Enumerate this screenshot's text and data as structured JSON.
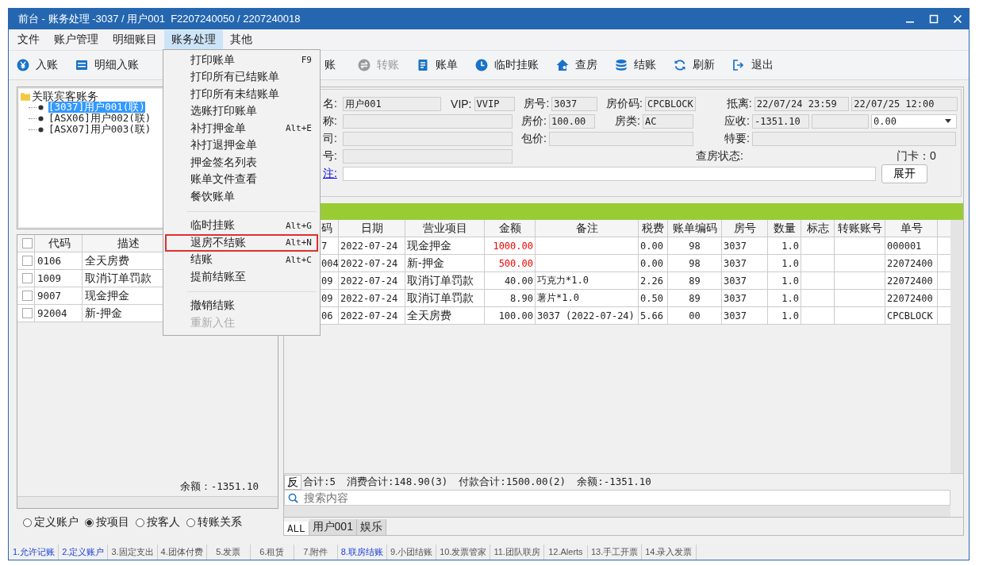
{
  "window": {
    "title": "前台 - 账务处理 -3037 / 用户001  F2207240050 / 2207240018"
  },
  "menu_bar": [
    {
      "label": "文件",
      "selected": false
    },
    {
      "label": "账户管理",
      "selected": false
    },
    {
      "label": "明细账目",
      "selected": false
    },
    {
      "label": "账务处理",
      "selected": true
    },
    {
      "label": "其他",
      "selected": false
    }
  ],
  "toolbar": [
    {
      "label": "入账",
      "disabled": false
    },
    {
      "label": "明细入账",
      "disabled": false
    },
    {
      "label": "账",
      "disabled": false
    },
    {
      "label": "转账",
      "disabled": true
    },
    {
      "label": "账单",
      "disabled": false
    },
    {
      "label": "临时挂账",
      "disabled": false
    },
    {
      "label": "查房",
      "disabled": false
    },
    {
      "label": "结账",
      "disabled": false
    },
    {
      "label": "刷新",
      "disabled": false
    },
    {
      "label": "退出",
      "disabled": false
    }
  ],
  "tree": {
    "root": "关联宾客账务",
    "children": [
      {
        "label": "[3037]用户001(联)",
        "selected": true
      },
      {
        "label": "[ASX06]用户002(联)",
        "selected": false
      },
      {
        "label": "[ASX07]用户003(联)",
        "selected": false
      }
    ]
  },
  "item_grid": {
    "header_checked": false,
    "columns": [
      "代码",
      "描述"
    ],
    "rows": [
      {
        "code": "0106",
        "desc": "全天房费",
        "checked": false
      },
      {
        "code": "1009",
        "desc": "取消订单罚款",
        "checked": false
      },
      {
        "code": "9007",
        "desc": "现金押金",
        "checked": false
      },
      {
        "code": "92004",
        "desc": "新-押金",
        "checked": false
      }
    ],
    "balance": "余额：-1351.10"
  },
  "view_options": [
    {
      "label": "定义账户",
      "selected": false
    },
    {
      "label": "按项目",
      "selected": true
    },
    {
      "label": "按客人",
      "selected": false
    },
    {
      "label": "转账关系",
      "selected": false
    }
  ],
  "guest_form": {
    "name_label": "名:",
    "name": "用户001",
    "vip_label": "VIP:",
    "vip": "VVIP",
    "room_label": "房号:",
    "room": "3037",
    "rate_code_label": "房价码:",
    "rate_code": "CPCBLOCK",
    "stay_label": "抵离:",
    "arrival": "22/07/24 23:59",
    "departure": "22/07/25 12:00",
    "title_label": "称:",
    "rate_label": "房价:",
    "rate": "100.00",
    "room_type_label": "房类:",
    "room_type": "AC",
    "receivable_label": "应收:",
    "receivable": "-1351.10",
    "receivable_select": "0.00",
    "company_label": "司:",
    "package_label": "包价:",
    "special_label": "特要:",
    "number_label": "号:",
    "check_status_label": "查房状态:",
    "door_card": "门卡：0",
    "remark_link": "注:",
    "expand_button": "展开"
  },
  "ledger": {
    "columns": [
      "码",
      "日期",
      "营业项目",
      "金额",
      "备注",
      "税费",
      "账单编码",
      "房号",
      "数量",
      "标志",
      "转账账号",
      "单号"
    ],
    "rows": [
      {
        "code": "7",
        "date": "2022-07-24",
        "item": "现金押金",
        "amount": "1000.00",
        "remark": "",
        "tax": "0.00",
        "bill_code": "98",
        "room": "3037",
        "qty": "1.0",
        "bill_no": "000001",
        "kind": "payment"
      },
      {
        "code": "004",
        "date": "2022-07-24",
        "item": "新-押金",
        "amount": "500.00",
        "remark": "",
        "tax": "0.00",
        "bill_code": "98",
        "room": "3037",
        "qty": "1.0",
        "bill_no": "22072400",
        "kind": "payment"
      },
      {
        "code": "09",
        "date": "2022-07-24",
        "item": "取消订单罚款",
        "amount": "40.00",
        "remark": "巧克力*1.0",
        "tax": "2.26",
        "bill_code": "89",
        "room": "3037",
        "qty": "1.0",
        "bill_no": "22072400",
        "kind": "charge"
      },
      {
        "code": "09",
        "date": "2022-07-24",
        "item": "取消订单罚款",
        "amount": "8.90",
        "remark": "薯片*1.0",
        "tax": "0.50",
        "bill_code": "89",
        "room": "3037",
        "qty": "1.0",
        "bill_no": "22072400",
        "kind": "charge"
      },
      {
        "code": "06",
        "date": "2022-07-24",
        "item": "全天房费",
        "amount": "100.00",
        "remark": "3037 (2022-07-24)",
        "tax": "5.66",
        "bill_code": "00",
        "room": "3037",
        "qty": "1.0",
        "bill_no": "CPCBLOCK",
        "kind": "charge"
      }
    ]
  },
  "summary": {
    "reverse_button": "反",
    "count": "合计:5",
    "consumption": "消费合计:148.90(3)",
    "payment": "付款合计:1500.00(2)",
    "balance": "余额:-1351.10"
  },
  "search": {
    "placeholder": "搜索内容"
  },
  "guest_tabs": [
    {
      "label": "ALL",
      "selected": true
    },
    {
      "label": "用户001",
      "selected": false
    },
    {
      "label": "娱乐",
      "selected": false
    }
  ],
  "status_tabs": [
    {
      "label": "1.允许记账",
      "highlighted": true
    },
    {
      "label": "2.定义账户",
      "highlighted": true
    },
    {
      "label": "3.固定支出",
      "highlighted": false
    },
    {
      "label": "4.团体付费",
      "highlighted": false
    },
    {
      "label": "5.发票",
      "highlighted": false
    },
    {
      "label": "6.租赁",
      "highlighted": false
    },
    {
      "label": "7.附件",
      "highlighted": false
    },
    {
      "label": "8.联房结账",
      "highlighted": true
    },
    {
      "label": "9.小团结账",
      "highlighted": false
    },
    {
      "label": "10.发票管家",
      "highlighted": false
    },
    {
      "label": "11.团队联房",
      "highlighted": false
    },
    {
      "label": "12.Alerts",
      "highlighted": false
    },
    {
      "label": "13.手工开票",
      "highlighted": false
    },
    {
      "label": "14.录入发票",
      "highlighted": false
    }
  ],
  "dropdown_menu": [
    {
      "kind": "item",
      "label": "打印账单",
      "shortcut": "F9",
      "disabled": false,
      "boxed": false
    },
    {
      "kind": "item",
      "label": "打印所有已结账单",
      "disabled": false,
      "boxed": false
    },
    {
      "kind": "item",
      "label": "打印所有未结账单",
      "disabled": false,
      "boxed": false
    },
    {
      "kind": "item",
      "label": "选账打印账单",
      "disabled": false,
      "boxed": false
    },
    {
      "kind": "item",
      "label": "补打押金单",
      "shortcut": "Alt+E",
      "disabled": false,
      "boxed": false
    },
    {
      "kind": "item",
      "label": "补打退押金单",
      "disabled": false,
      "boxed": false
    },
    {
      "kind": "item",
      "label": "押金签名列表",
      "disabled": false,
      "boxed": false
    },
    {
      "kind": "item",
      "label": "账单文件查看",
      "disabled": false,
      "boxed": false
    },
    {
      "kind": "item",
      "label": "餐饮账单",
      "disabled": false,
      "boxed": false
    },
    {
      "kind": "separator"
    },
    {
      "kind": "item",
      "label": "临时挂账",
      "shortcut": "Alt+G",
      "disabled": false,
      "boxed": false
    },
    {
      "kind": "item",
      "label": "退房不结账",
      "shortcut": "Alt+N",
      "disabled": false,
      "boxed": true
    },
    {
      "kind": "item",
      "label": "结账",
      "shortcut": "Alt+C",
      "disabled": false,
      "boxed": false
    },
    {
      "kind": "item",
      "label": "提前结账至",
      "disabled": false,
      "boxed": false
    },
    {
      "kind": "separator"
    },
    {
      "kind": "item",
      "label": "撤销结账",
      "disabled": false,
      "boxed": false
    },
    {
      "kind": "item",
      "label": "重新入住",
      "disabled": true,
      "boxed": false
    }
  ]
}
